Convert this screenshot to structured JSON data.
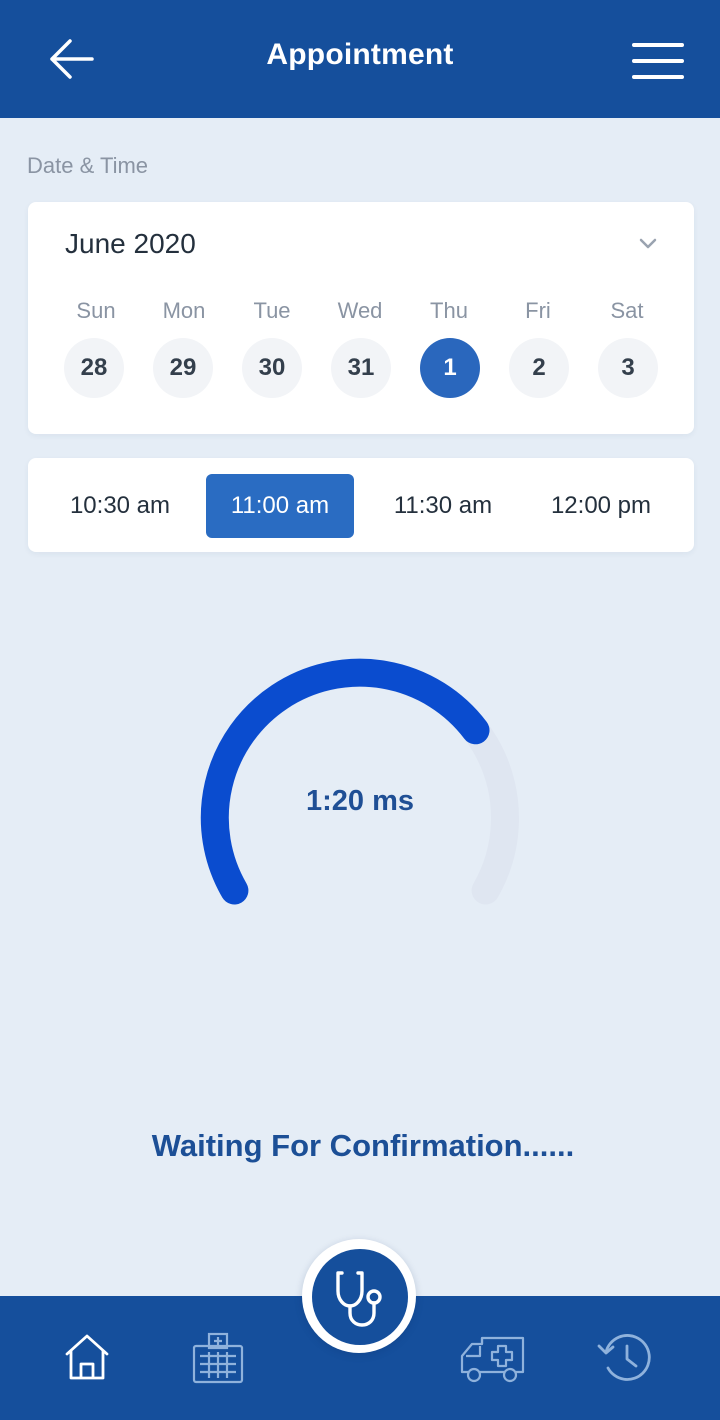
{
  "header": {
    "title": "Appointment",
    "back_icon": "arrow-left-icon",
    "menu_icon": "hamburger-menu-icon"
  },
  "section_label": "Date & Time",
  "calendar": {
    "month": "June 2020",
    "day_names": [
      "Sun",
      "Mon",
      "Tue",
      "Wed",
      "Thu",
      "Fri",
      "Sat"
    ],
    "dates": [
      "28",
      "29",
      "30",
      "31",
      "1",
      "2",
      "3"
    ],
    "selected_index": 4
  },
  "time_slots": {
    "slots": [
      "10:30 am",
      "11:00 am",
      "11:30 am",
      "12:00 pm"
    ],
    "selected_index": 1
  },
  "timer": {
    "value": "1:20 ms",
    "progress": 0.72
  },
  "status": "Waiting For Confirmation......",
  "nav": {
    "items": [
      "home-icon",
      "hospital-icon",
      "stethoscope-icon",
      "ambulance-icon",
      "history-icon"
    ]
  },
  "colors": {
    "primary": "#154f9c",
    "accent": "#2a6cc2",
    "gauge": "#0a4ccf",
    "gauge_track": "#dfe6f1"
  }
}
